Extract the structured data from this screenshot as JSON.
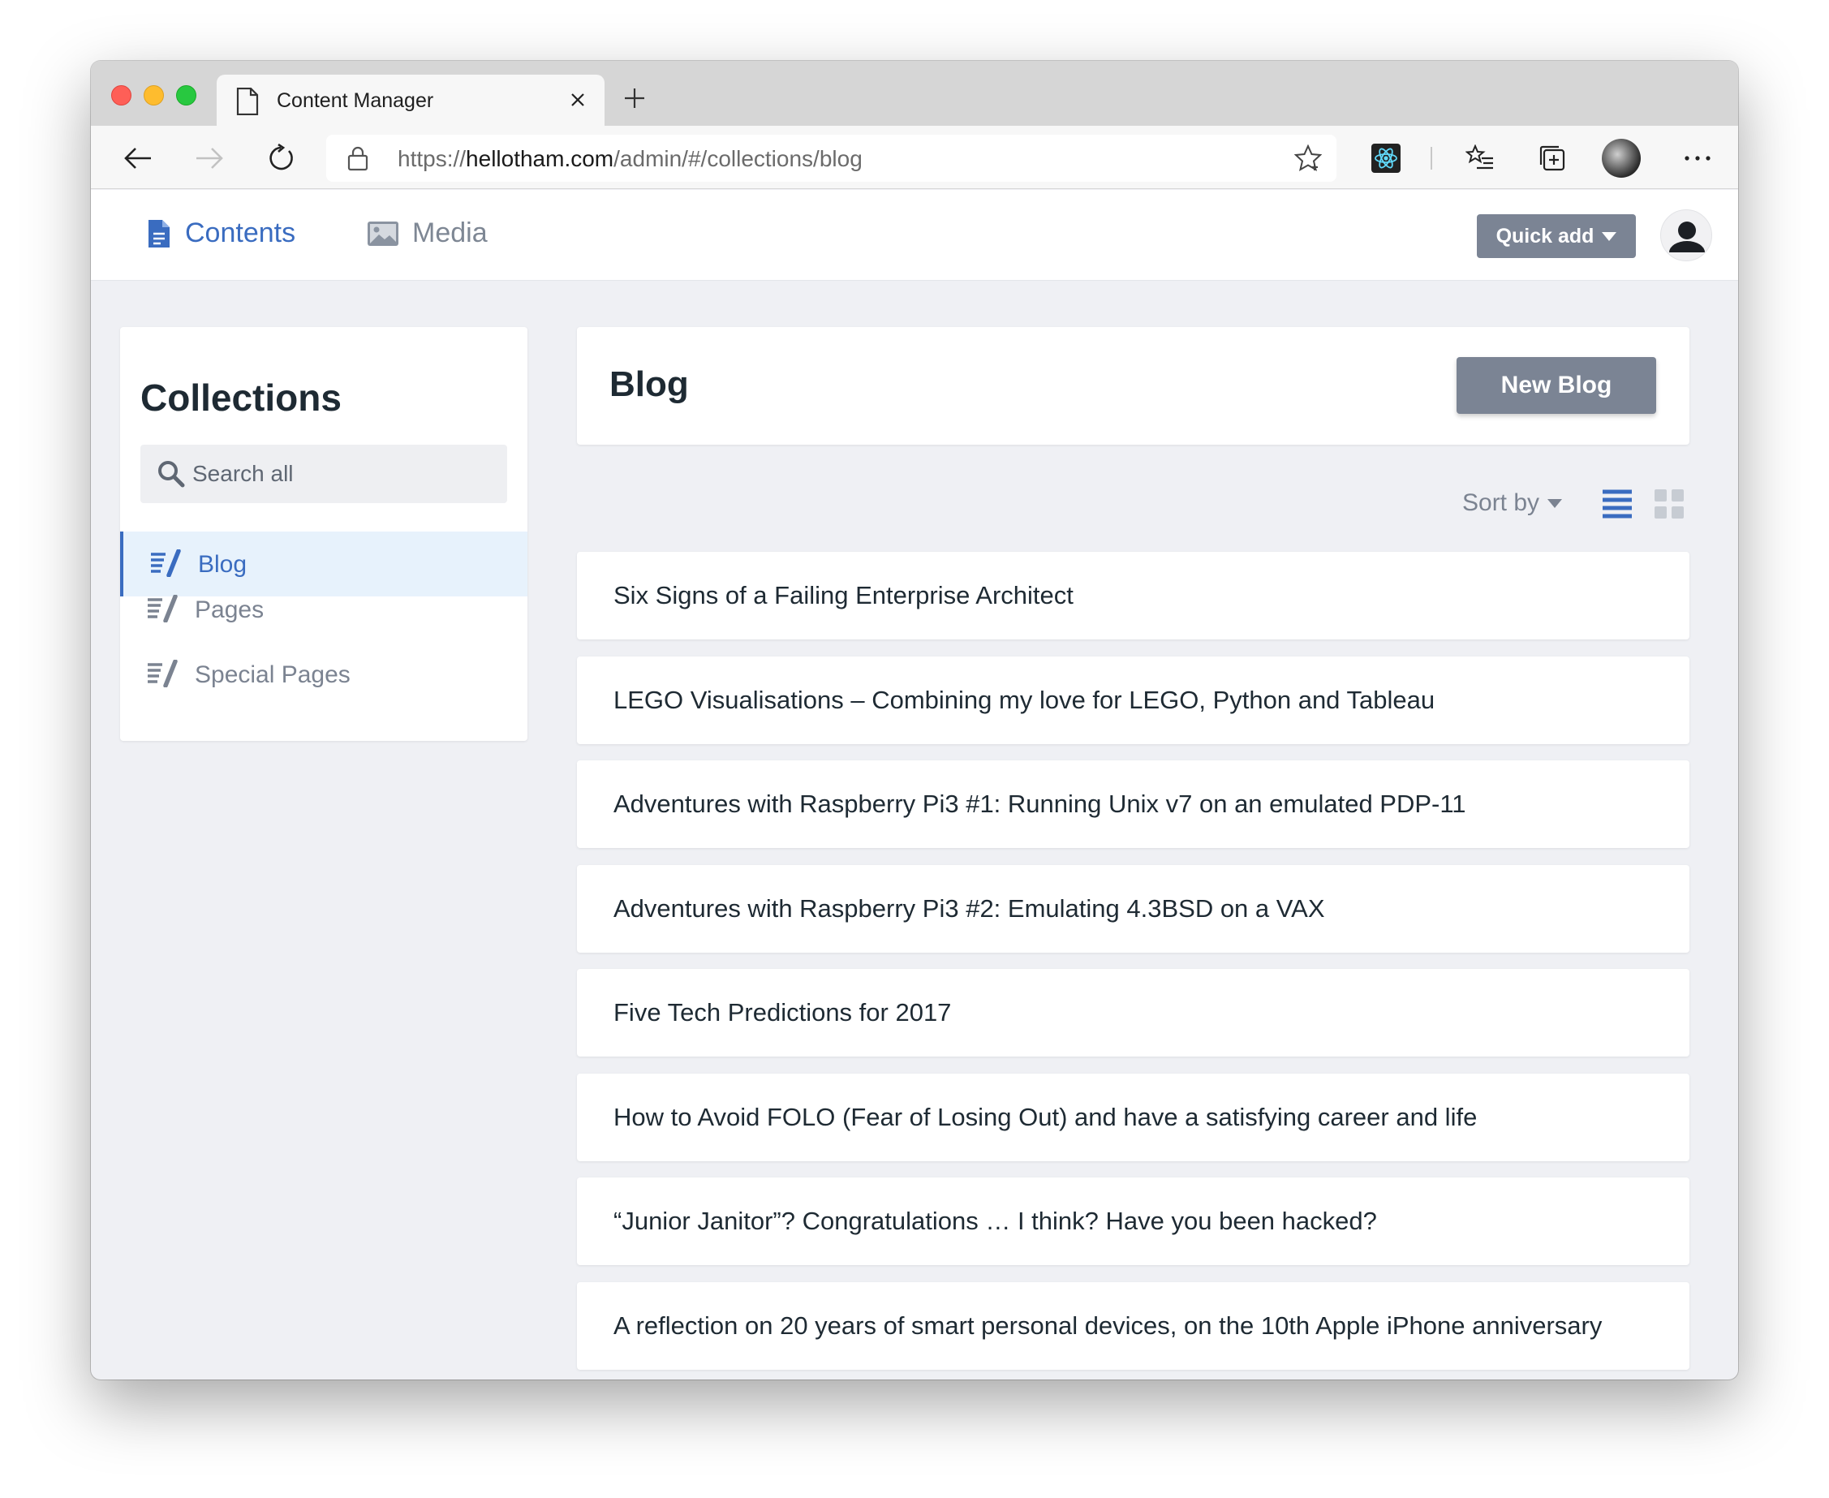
{
  "browser": {
    "tab_title": "Content Manager",
    "url_scheme": "https://",
    "url_host": "hellotham.com",
    "url_path": "/admin/#/collections/blog"
  },
  "header": {
    "nav": [
      {
        "label": "Contents",
        "icon": "document-icon",
        "active": true
      },
      {
        "label": "Media",
        "icon": "image-icon",
        "active": false
      }
    ],
    "quick_add_label": "Quick add"
  },
  "sidebar": {
    "title": "Collections",
    "search_placeholder": "Search all",
    "items": [
      {
        "label": "Blog",
        "icon": "collection-icon",
        "active": true
      },
      {
        "label": "Pages",
        "icon": "collection-icon",
        "active": false
      },
      {
        "label": "Special Pages",
        "icon": "collection-icon",
        "active": false
      }
    ]
  },
  "main": {
    "title": "Blog",
    "new_button_label": "New Blog",
    "sort_label": "Sort by",
    "entries": [
      "Six Signs of a Failing Enterprise Architect",
      "LEGO Visualisations – Combining my love for LEGO, Python and Tableau",
      "Adventures with Raspberry Pi3 #1: Running Unix v7 on an emulated PDP-11",
      "Adventures with Raspberry Pi3 #2: Emulating 4.3BSD on a VAX",
      "Five Tech Predictions for 2017",
      "How to Avoid FOLO (Fear of Losing Out) and have a satisfying career and life",
      "“Junior Janitor”? Congratulations … I think? Have you been hacked?",
      "A reflection on 20 years of smart personal devices, on the 10th Apple iPhone anniversary"
    ]
  },
  "colors": {
    "accent": "#3a6cc0",
    "button_gray": "#7b8494",
    "page_bg": "#eff0f4",
    "active_row_bg": "#e7f2fc"
  }
}
